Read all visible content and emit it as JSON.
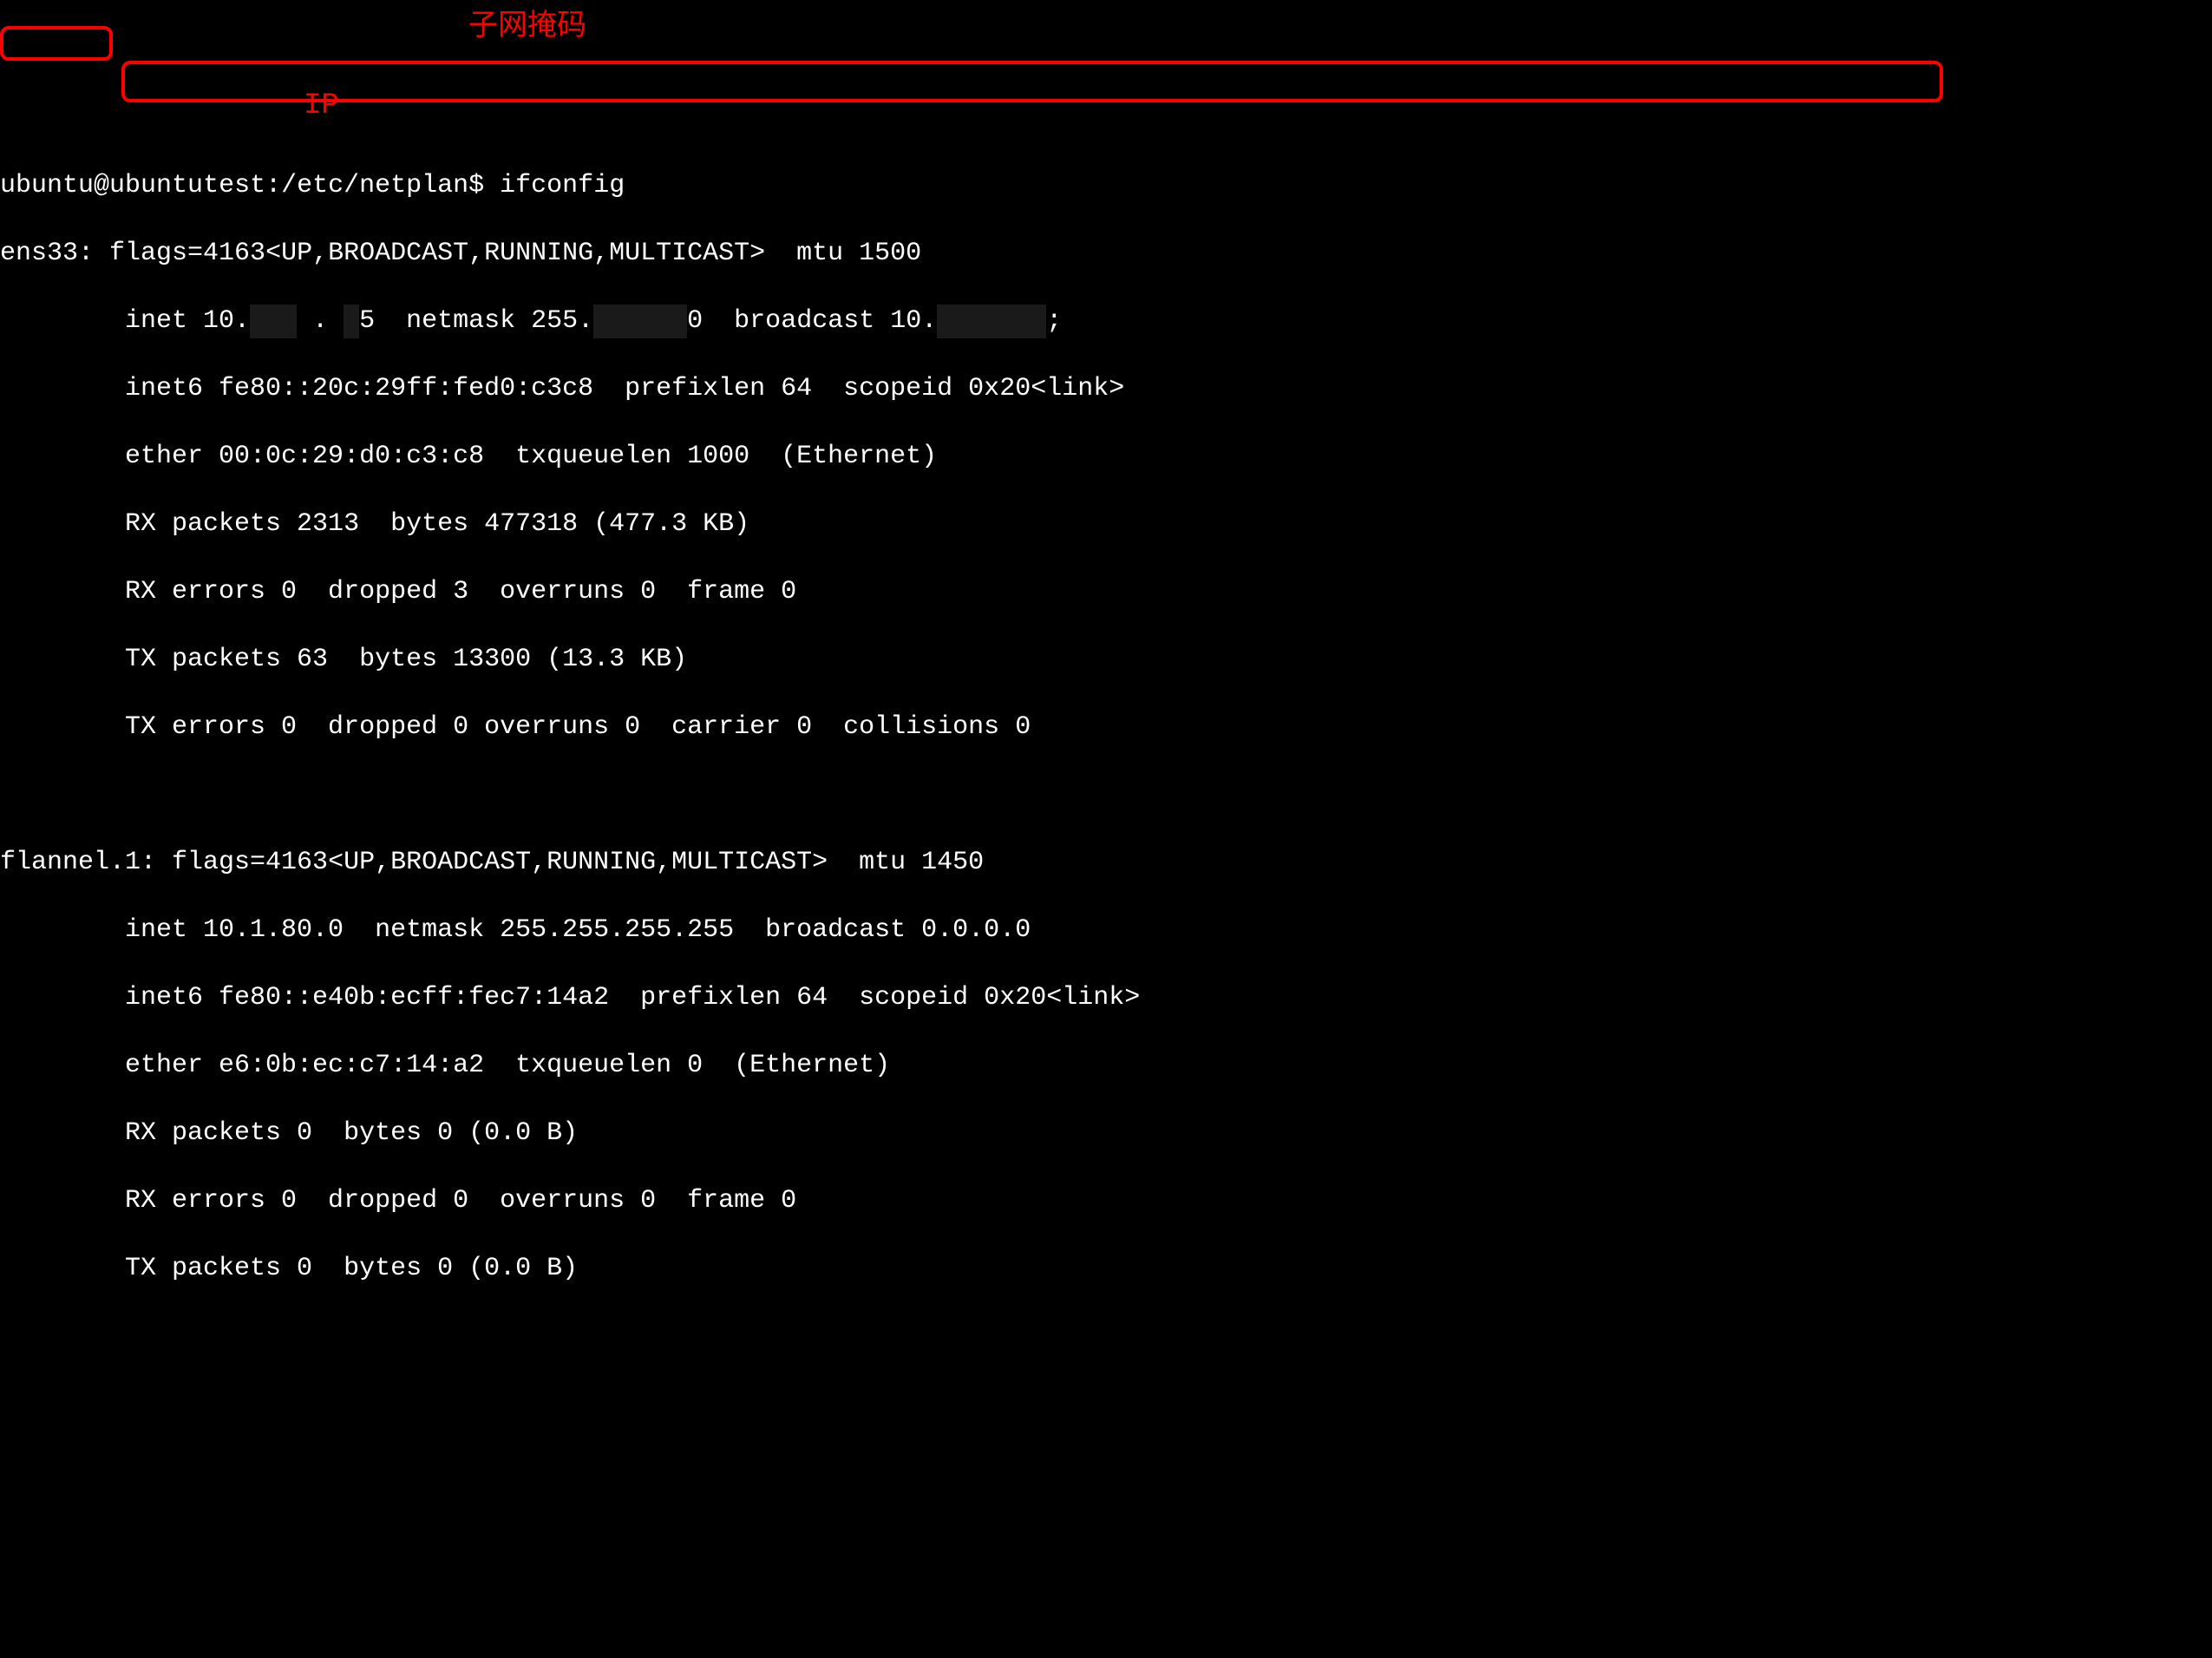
{
  "prompt": {
    "user": "ubuntu",
    "host": "ubuntutest",
    "cwd": "/etc/netplan",
    "symbol": "$",
    "command": "ifconfig"
  },
  "interfaces": [
    {
      "name": "ens33:",
      "flags_line": " flags=4163<UP,BROADCAST,RUNNING,MULTICAST>  mtu 1500",
      "inet_prefix": "        inet 10.",
      "inet_redact1": "███",
      "inet_mid1": " . ",
      "inet_redact1b": "█",
      "inet_mid2": "5  netmask 255.",
      "inet_redact2": "     █",
      "inet_mid3": "0  broadcast 10.",
      "inet_redact3": "███████",
      "inet_end": ";",
      "inet6_line": "        inet6 fe80::20c:29ff:fed0:c3c8  prefixlen 64  scopeid 0x20<link>",
      "ether_line": "        ether 00:0c:29:d0:c3:c8  txqueuelen 1000  (Ethernet)",
      "rx_packets_line": "        RX packets 2313  bytes 477318 (477.3 KB)",
      "rx_errors_line": "        RX errors 0  dropped 3  overruns 0  frame 0",
      "tx_packets_line": "        TX packets 63  bytes 13300 (13.3 KB)",
      "tx_errors_line": "        TX errors 0  dropped 0 overruns 0  carrier 0  collisions 0"
    },
    {
      "name": "flannel.1:",
      "flags_line": " flags=4163<UP,BROADCAST,RUNNING,MULTICAST>  mtu 1450",
      "inet_line": "        inet 10.1.80.0  netmask 255.255.255.255  broadcast 0.0.0.0",
      "inet6_line": "        inet6 fe80::e40b:ecff:fec7:14a2  prefixlen 64  scopeid 0x20<link>",
      "ether_line": "        ether e6:0b:ec:c7:14:a2  txqueuelen 0  (Ethernet)",
      "rx_packets_line": "        RX packets 0  bytes 0 (0.0 B)",
      "rx_errors_line": "        RX errors 0  dropped 0  overruns 0  frame 0",
      "tx_packets_line": "        TX packets 0  bytes 0 (0.0 B)"
    }
  ],
  "annotations": {
    "netmask_label": "子网掩码",
    "ip_label": "IP"
  }
}
